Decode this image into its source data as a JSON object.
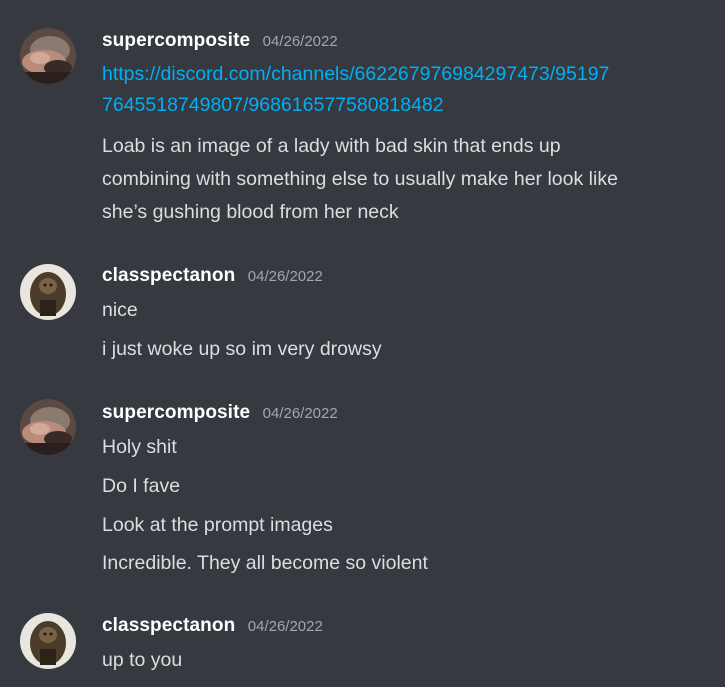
{
  "messages": [
    {
      "username": "supercomposite",
      "timestamp": "04/26/2022",
      "link_lines": [
        "https://discord.com/channels/662267976984297473/95197",
        "7645518749807/968616577580818482"
      ],
      "text_lines": [
        "Loab is an image of a lady with bad skin that ends up",
        "combining with something else to usually make her look like",
        "she’s gushing blood from her neck"
      ]
    },
    {
      "username": "classpectanon",
      "timestamp": "04/26/2022",
      "lines": [
        "nice",
        "i just woke up so im very drowsy"
      ]
    },
    {
      "username": "supercomposite",
      "timestamp": "04/26/2022",
      "lines": [
        "Holy shit",
        "Do I fave",
        "Look at the prompt images",
        "Incredible. They all become so violent"
      ]
    },
    {
      "username": "classpectanon",
      "timestamp": "04/26/2022",
      "lines": [
        "up to you"
      ]
    }
  ]
}
